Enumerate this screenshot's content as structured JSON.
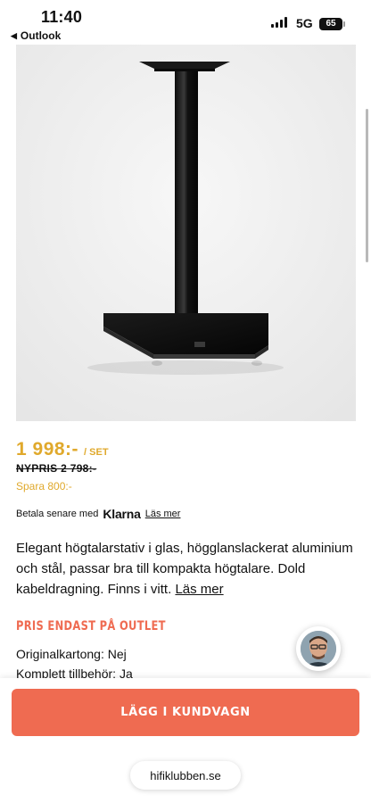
{
  "status_bar": {
    "time": "11:40",
    "back_app": "Outlook",
    "network": "5G",
    "battery": "65"
  },
  "product": {
    "image_icon": "speaker-stand-image",
    "price": "1 998:-",
    "price_unit": "/ SET",
    "regular_price": "NYPRIS 2 798:-",
    "savings": "Spara 800:-",
    "klarna_prefix": "Betala senare med",
    "klarna_brand": "Klarna",
    "klarna_link": "Läs mer",
    "description": "Elegant högtalarstativ i glas, högglanslackerat aluminium och stål, passar bra till kompakta högtalare. Dold kabeldragning. Finns i vitt.",
    "description_link": "Läs mer",
    "outlet_heading": "PRIS ENDAST PÅ OUTLET",
    "details": [
      "Originalkartong: Nej",
      "Komplett tillbehör: Ja"
    ]
  },
  "actions": {
    "add_to_cart": "LÄGG I KUNDVAGN"
  },
  "browser": {
    "url": "hifiklubben.se"
  },
  "colors": {
    "price": "#e0a92c",
    "accent": "#ef6b51"
  }
}
